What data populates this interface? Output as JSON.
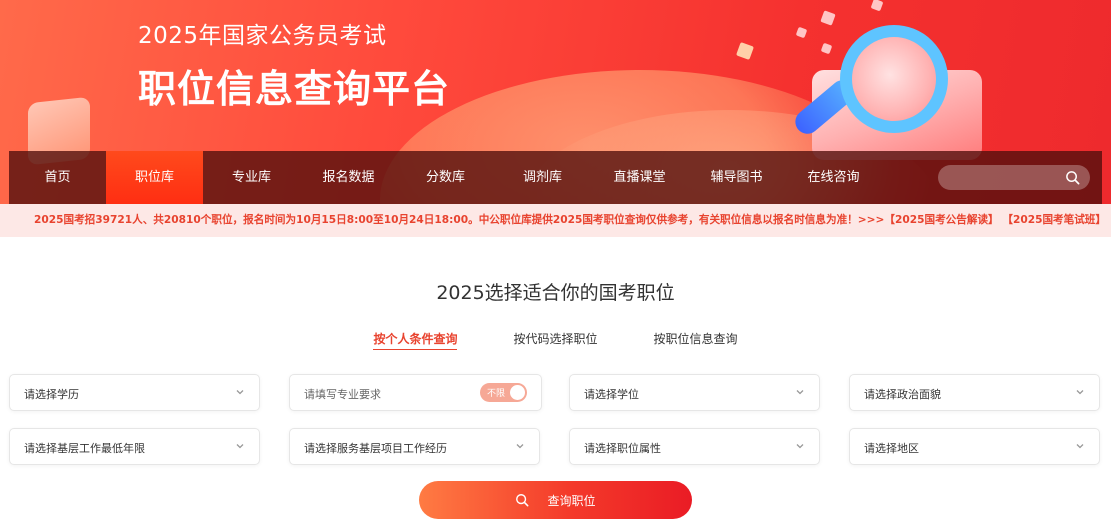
{
  "banner": {
    "subtitle": "2025年国家公务员考试",
    "title": "职位信息查询平台"
  },
  "nav": {
    "items": [
      {
        "label": "首页",
        "active": false
      },
      {
        "label": "职位库",
        "active": true
      },
      {
        "label": "专业库",
        "active": false
      },
      {
        "label": "报名数据",
        "active": false
      },
      {
        "label": "分数库",
        "active": false
      },
      {
        "label": "调剂库",
        "active": false
      },
      {
        "label": "直播课堂",
        "active": false
      },
      {
        "label": "辅导图书",
        "active": false
      },
      {
        "label": "在线咨询",
        "active": false
      }
    ],
    "search_value": "",
    "search_icon": "search-icon"
  },
  "notice": {
    "text": "2025国考招39721人、共20810个职位，报名时间为10月15日8:00至10月24日18:00。中公职位库提供2025国考职位查询仅供参考，有关职位信息以报名时信息为准！>>>",
    "link1": "【2025国考公告解读】",
    "link2": "【2025国考笔试班】"
  },
  "main": {
    "heading": "2025选择适合你的国考职位",
    "tabs": [
      {
        "label": "按个人条件查询",
        "active": true
      },
      {
        "label": "按代码选择职位",
        "active": false
      },
      {
        "label": "按职位信息查询",
        "active": false
      }
    ],
    "filters": {
      "education": "请选择学历",
      "major": "请填写专业要求",
      "major_toggle": "不限",
      "degree": "请选择学位",
      "political": "请选择政治面貌",
      "grassroots_years": "请选择基层工作最低年限",
      "service_project": "请选择服务基层项目工作经历",
      "position_attr": "请选择职位属性",
      "region": "请选择地区"
    },
    "query_button": "查询职位"
  },
  "colors": {
    "accent": "#e8432f",
    "nav_active": "#ff3a18",
    "notice_bg": "#fde8e6"
  }
}
